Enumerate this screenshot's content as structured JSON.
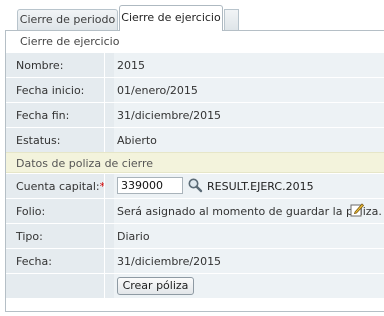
{
  "tabs": [
    {
      "label": "Cierre de periodo",
      "active": false
    },
    {
      "label": "Cierre de ejercicio",
      "active": true
    }
  ],
  "panel": {
    "title": "Cierre de ejercicio"
  },
  "info_rows": [
    {
      "label": "Nombre:",
      "value": "2015"
    },
    {
      "label": "Fecha inicio:",
      "value": "01/enero/2015"
    },
    {
      "label": "Fecha fin:",
      "value": "31/diciembre/2015"
    },
    {
      "label": "Estatus:",
      "value": "Abierto"
    }
  ],
  "section": {
    "title": "Datos de poliza de cierre"
  },
  "form": {
    "cuenta_label": "Cuenta capital:",
    "required_mark": "*",
    "cuenta_value": "339000",
    "cuenta_name": "RESULT.EJERC.2015",
    "folio_label": "Folio:",
    "folio_value": "Será asignado al momento de guardar la póliza.",
    "tipo_label": "Tipo:",
    "tipo_value": "Diario",
    "fecha_label": "Fecha:",
    "fecha_value": "31/diciembre/2015",
    "submit_label": "Crear póliza"
  },
  "icons": {
    "lookup": "search-icon",
    "edit": "edit-icon"
  },
  "colors": {
    "label_bg": "#e5ebef",
    "value_bg": "#edf2f5",
    "section_bg": "#f3f3dc",
    "required": "#d40000"
  }
}
